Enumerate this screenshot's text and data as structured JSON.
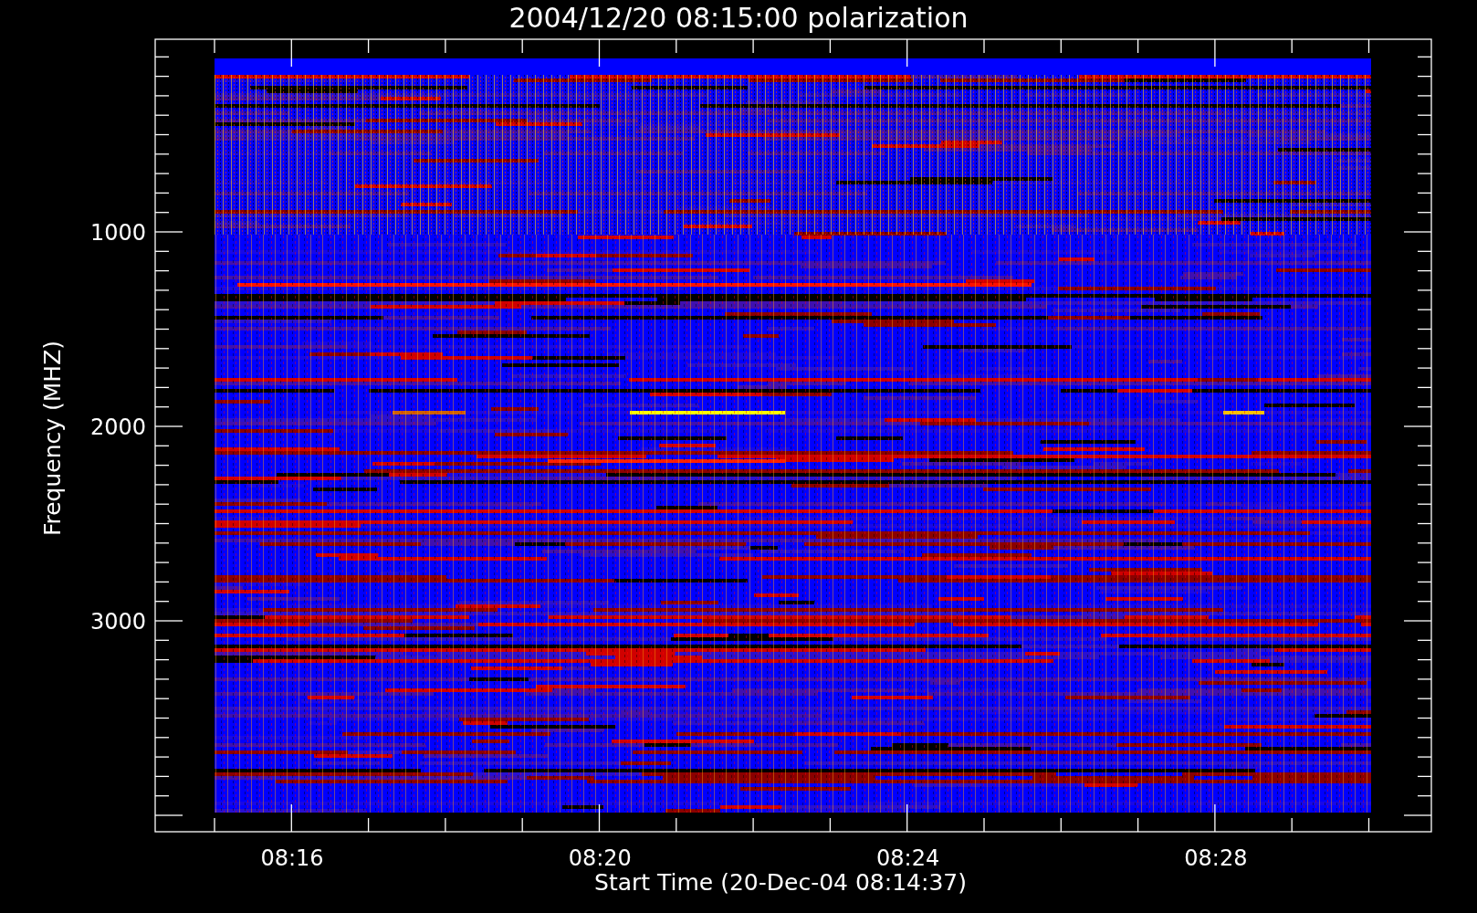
{
  "title": "2004/12/20 08:15:00 polarization",
  "y_axis": {
    "label": "Frequency (MHZ)",
    "ticks": [
      "1000",
      "2000",
      "3000"
    ]
  },
  "x_axis": {
    "label": "Start Time (20-Dec-04 08:14:37)",
    "ticks": [
      "08:16",
      "08:20",
      "08:24",
      "08:28"
    ]
  }
}
